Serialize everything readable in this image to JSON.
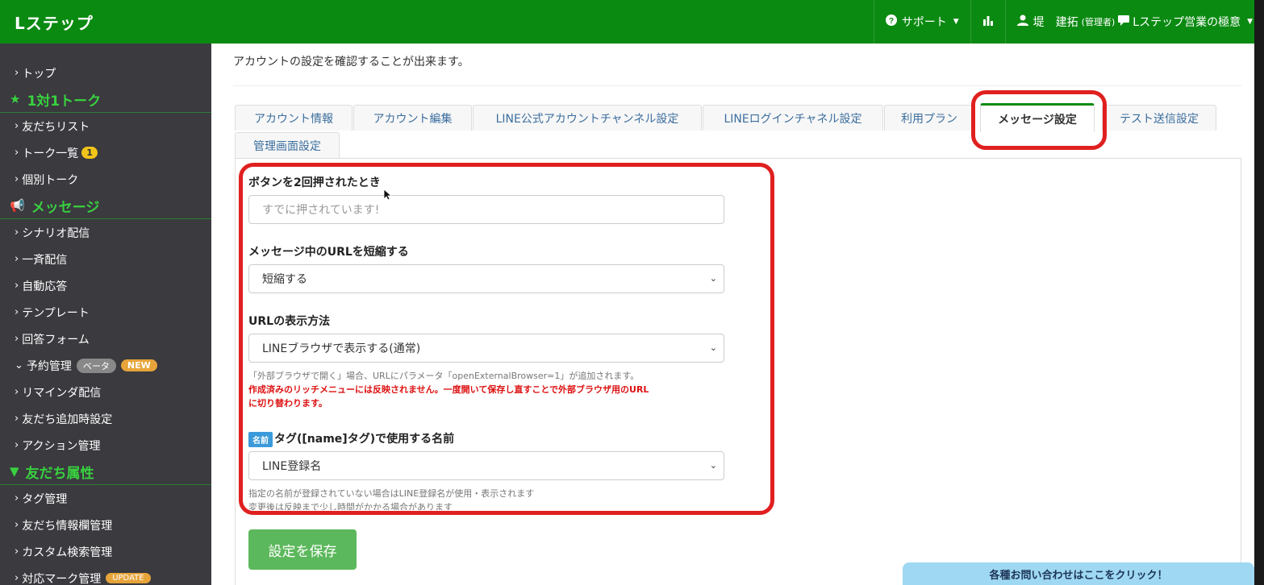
{
  "header": {
    "brand": "Lステップ",
    "support_label": "サポート",
    "user_name": "堤　建拓",
    "user_role": "(管理者)",
    "account_name": "Lステップ営業の極意"
  },
  "sidebar": {
    "items": [
      {
        "type": "link",
        "label": "トップ"
      },
      {
        "type": "section",
        "label": "1対1トーク",
        "icon": "star-icon"
      },
      {
        "type": "link",
        "label": "友だちリスト"
      },
      {
        "type": "link",
        "label": "トーク一覧",
        "badge": "1"
      },
      {
        "type": "link",
        "label": "個別トーク"
      },
      {
        "type": "section",
        "label": "メッセージ",
        "icon": "megaphone-icon"
      },
      {
        "type": "link",
        "label": "シナリオ配信"
      },
      {
        "type": "link",
        "label": "一斉配信"
      },
      {
        "type": "link",
        "label": "自動応答"
      },
      {
        "type": "link",
        "label": "テンプレート"
      },
      {
        "type": "link",
        "label": "回答フォーム"
      },
      {
        "type": "link",
        "label": "予約管理",
        "beta": "ベータ",
        "new": "NEW"
      },
      {
        "type": "link",
        "label": "リマインダ配信"
      },
      {
        "type": "link",
        "label": "友だち追加時設定"
      },
      {
        "type": "link",
        "label": "アクション管理"
      },
      {
        "type": "section",
        "label": "友だち属性",
        "icon": "filter-icon"
      },
      {
        "type": "link",
        "label": "タグ管理"
      },
      {
        "type": "link",
        "label": "友だち情報欄管理"
      },
      {
        "type": "link",
        "label": "カスタム検索管理"
      },
      {
        "type": "link",
        "label": "対応マーク管理",
        "update": "UPDATE"
      }
    ]
  },
  "main": {
    "intro": "アカウントの設定を確認することが出来ます。",
    "tabs": [
      {
        "label": "アカウント情報"
      },
      {
        "label": "アカウント編集"
      },
      {
        "label": "LINE公式アカウントチャンネル設定"
      },
      {
        "label": "LINEログインチャネル設定"
      },
      {
        "label": "利用プラン"
      },
      {
        "label": "メッセージ設定",
        "active": true
      },
      {
        "label": "テスト送信設定"
      },
      {
        "label": "管理画面設定"
      }
    ],
    "form": {
      "double_press_label": "ボタンを2回押されたとき",
      "double_press_placeholder": "すでに押されています!",
      "shorten_label": "メッセージ中のURLを短縮する",
      "shorten_value": "短縮する",
      "url_display_label": "URLの表示方法",
      "url_display_value": "LINEブラウザで表示する(通常)",
      "url_help": "「外部ブラウザで開く」場合、URLにパラメータ「openExternalBrowser=1」が追加されます。",
      "url_warning_line1": "作成済みのリッチメニューには反映されません。一度開いて保存し直すことで外部ブラウザ用のURL",
      "url_warning_line2": "に切り替わります。",
      "name_chip": "名前",
      "name_label": "タグ([name]タグ)で使用する名前",
      "name_value": "LINE登録名",
      "name_help1": "指定の名前が登録されていない場合はLINE登録名が使用・表示されます",
      "name_help2": "変更後は反映まで少し時間がかかる場合があります"
    },
    "save_label": "設定を保存",
    "contact_label": "各種お問い合わせはここをクリック！"
  },
  "colors": {
    "brand_green": "#0b8a12",
    "sidebar_bg": "#3a3a3f",
    "annotation_red": "#e02020",
    "save_green": "#5cb85c"
  }
}
